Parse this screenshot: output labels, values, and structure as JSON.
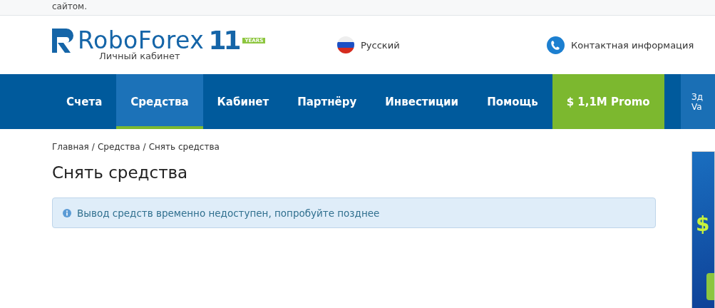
{
  "notice_strip": {
    "text": "сайтом."
  },
  "header": {
    "logo": {
      "name": "RoboForex",
      "years": "11",
      "years_label": "YEARS",
      "subtitle": "Личный кабинет"
    },
    "language": "Русский",
    "contact": "Контактная информация"
  },
  "nav": {
    "items": [
      {
        "label": "Счета",
        "selected": false,
        "kind": "plain"
      },
      {
        "label": "Средства",
        "selected": true,
        "kind": "plain"
      },
      {
        "label": "Кабинет",
        "selected": false,
        "kind": "plain"
      },
      {
        "label": "Партнёру",
        "selected": false,
        "kind": "plain"
      },
      {
        "label": "Инвестиции",
        "selected": false,
        "kind": "plain"
      },
      {
        "label": "Помощь",
        "selected": false,
        "kind": "plain"
      },
      {
        "label": "$ 1,1M Promo",
        "selected": false,
        "kind": "promo"
      }
    ],
    "side_box": [
      "Зд",
      "Va"
    ]
  },
  "breadcrumbs": {
    "separator": "/",
    "items": [
      "Главная",
      "Средства",
      "Снять средства"
    ]
  },
  "page_title": "Снять средства",
  "alert": {
    "text": "Вывод средств временно недоступен, попробуйте позднее"
  },
  "banner": {
    "symbol": "$"
  }
}
